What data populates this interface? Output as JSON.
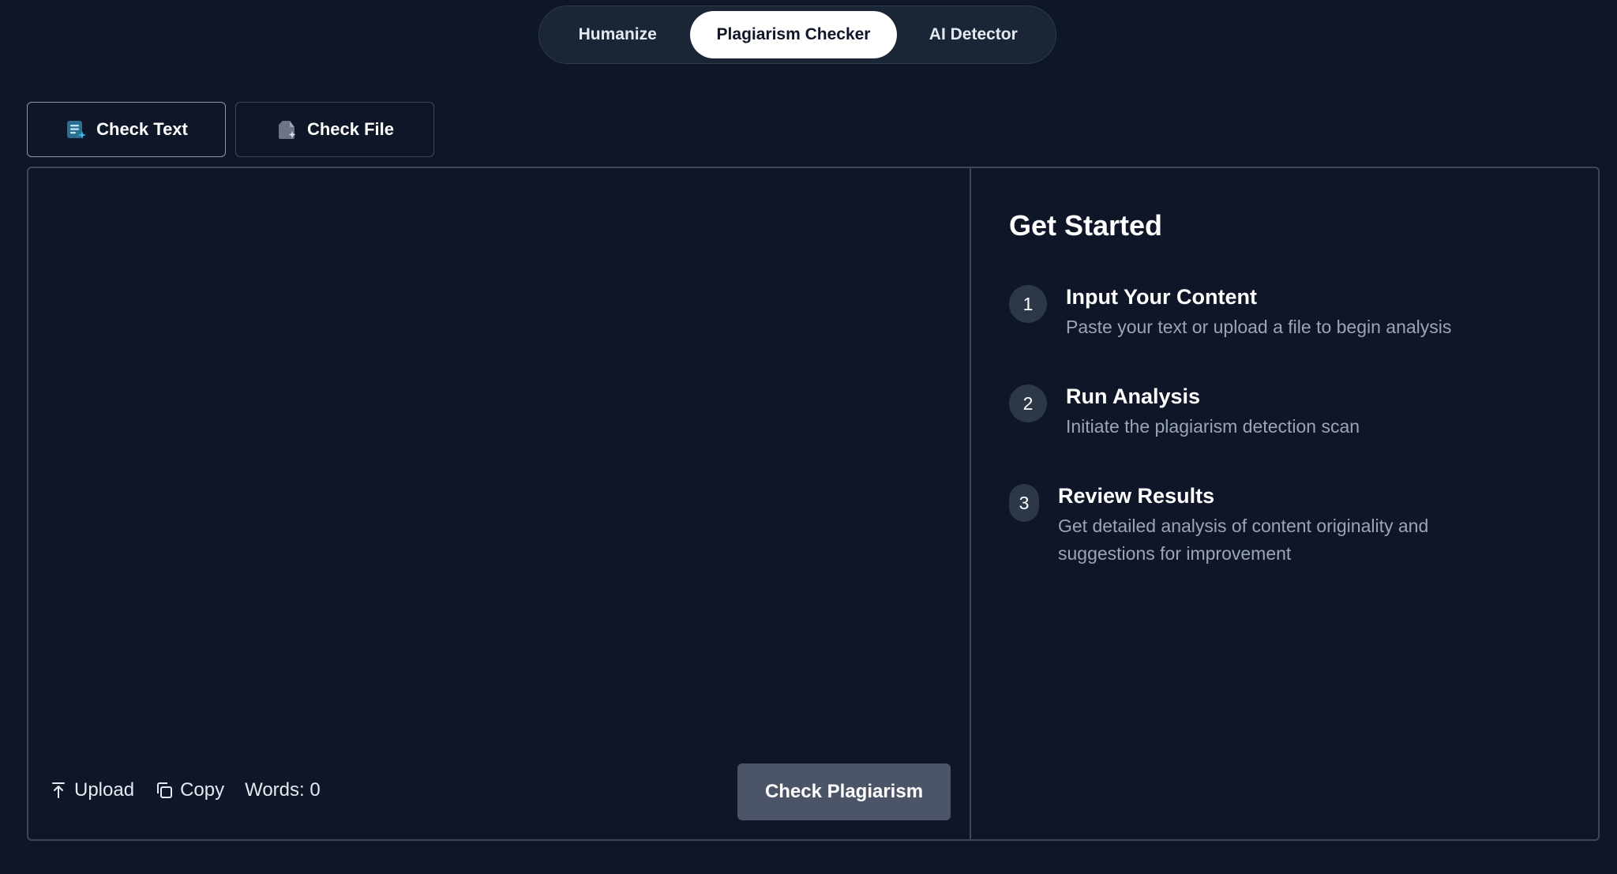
{
  "topnav": {
    "tabs": [
      {
        "label": "Humanize"
      },
      {
        "label": "Plagiarism Checker"
      },
      {
        "label": "AI Detector"
      }
    ],
    "active_index": 1
  },
  "mode_tabs": [
    {
      "label": "Check Text",
      "icon": "text-document-icon"
    },
    {
      "label": "Check File",
      "icon": "file-icon"
    }
  ],
  "editor": {
    "placeholder": "",
    "upload_label": "Upload",
    "copy_label": "Copy",
    "word_count": "Words: 0",
    "submit_label": "Check Plagiarism"
  },
  "guide": {
    "title": "Get Started",
    "steps": [
      {
        "number": "1",
        "title": "Input Your Content",
        "desc": "Paste your text or upload a file to begin analysis"
      },
      {
        "number": "2",
        "title": "Run Analysis",
        "desc": "Initiate the plagiarism detection scan"
      },
      {
        "number": "3",
        "title": "Review Results",
        "desc": "Get detailed analysis of content originality and suggestions for improvement"
      }
    ]
  },
  "colors": {
    "background": "#0e1628",
    "accent_icon": "#3fb6e8",
    "button": "#4b5567"
  }
}
